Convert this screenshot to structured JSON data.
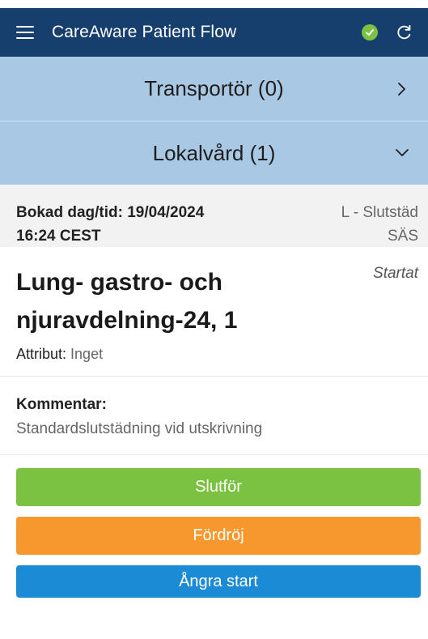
{
  "app": {
    "title": "CareAware Patient Flow",
    "status_icon": "check-circle-icon",
    "status_color": "#7cc242"
  },
  "sections": [
    {
      "label": "Transportör (0)",
      "icon": "chevron-right-icon"
    },
    {
      "label": "Lokalvård (1)",
      "icon": "chevron-down-icon"
    }
  ],
  "booking": {
    "line1": "Bokad dag/tid: 19/04/2024",
    "line2": "16:24 CEST",
    "type": "L - Slutstäd",
    "site": "SÄS"
  },
  "location": {
    "title": "Lung- gastro- och njuravdelning-24, 1",
    "status": "Startat",
    "attr_label": "Attribut:",
    "attr_value": "Inget"
  },
  "comment": {
    "label": "Kommentar:",
    "text": "Standardslutstädning vid utskrivning"
  },
  "actions": {
    "complete": "Slutför",
    "delay": "Fördröj",
    "undo": "Ångra start"
  },
  "colors": {
    "appbar": "#163f6e",
    "section": "#a9c8e3",
    "complete": "#7cc242",
    "delay": "#f7982e",
    "undo": "#1c8bd6"
  }
}
